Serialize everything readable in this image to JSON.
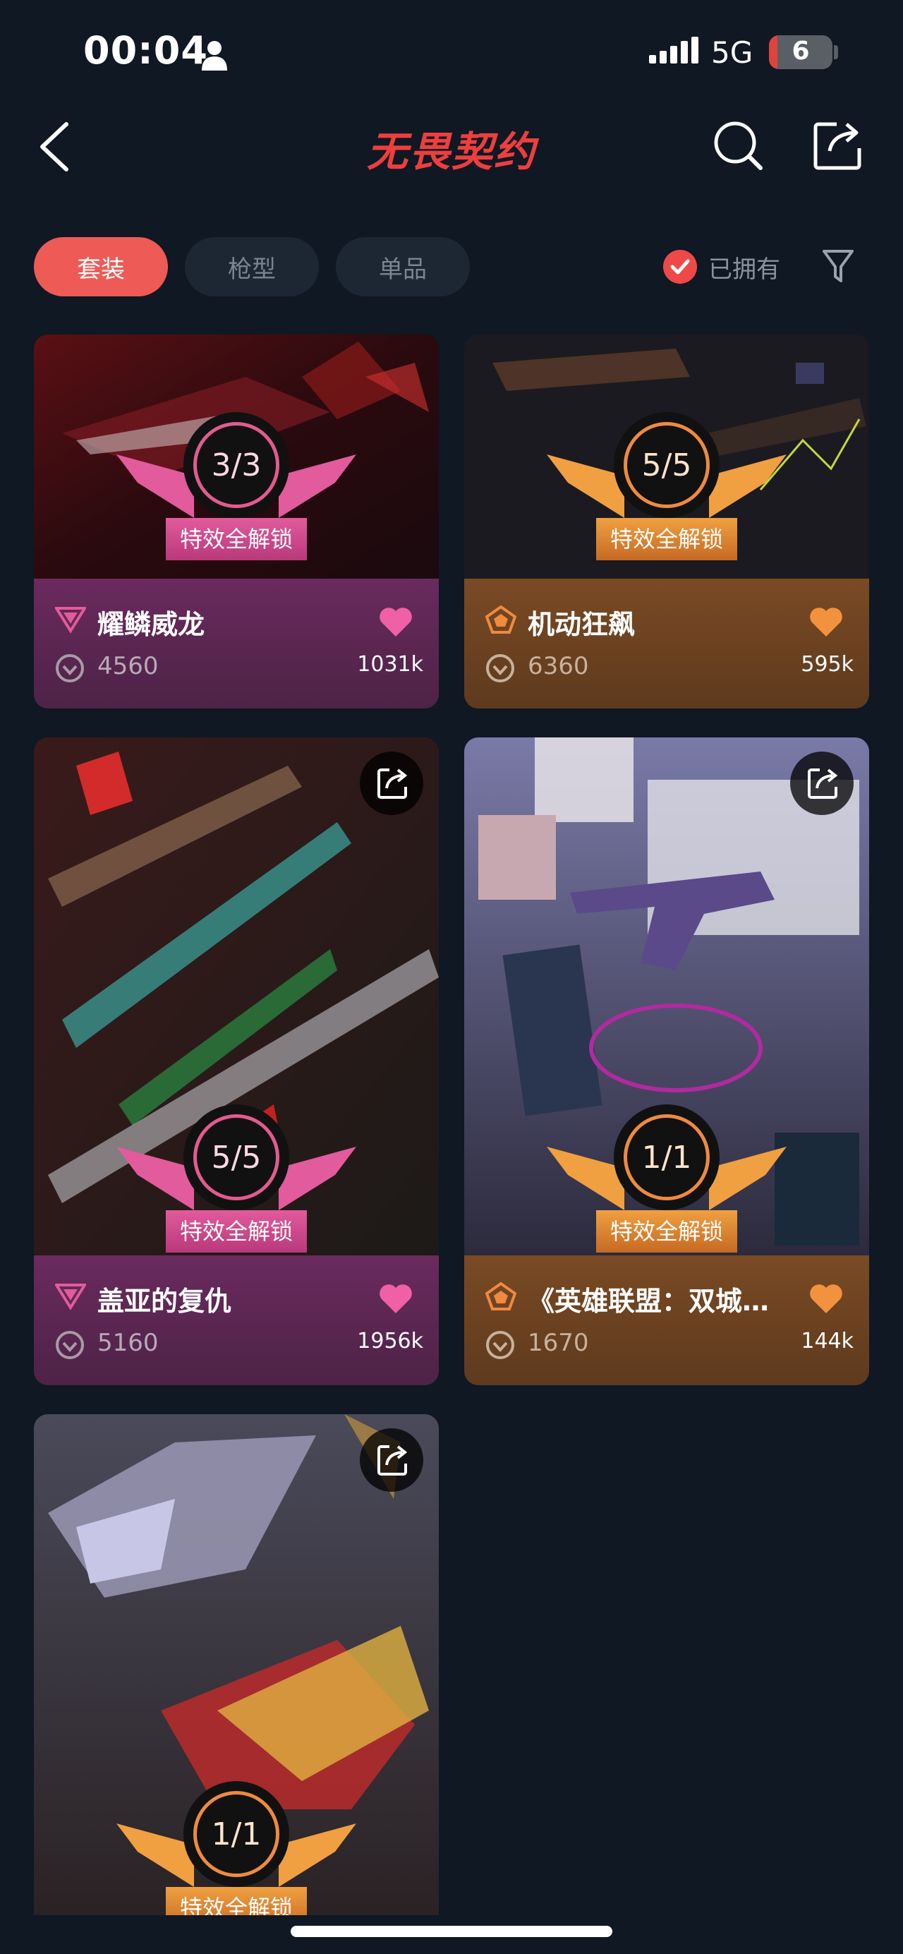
{
  "status_bar": {
    "time": "00:04",
    "network": "5G",
    "battery": "6"
  },
  "header": {
    "title": "无畏契约"
  },
  "filters": {
    "tabs": [
      {
        "label": "套装"
      },
      {
        "label": "枪型"
      },
      {
        "label": "单品"
      }
    ],
    "owned_label": "已拥有"
  },
  "cards": [
    {
      "name": "耀鳞威龙",
      "price": "4560",
      "likes": "1031k",
      "unlocked": "3/3",
      "badge_label": "特效全解锁"
    },
    {
      "name": "机动狂飙",
      "price": "6360",
      "likes": "595k",
      "unlocked": "5/5",
      "badge_label": "特效全解锁"
    },
    {
      "name": "盖亚的复仇",
      "price": "5160",
      "likes": "1956k",
      "unlocked": "5/5",
      "badge_label": "特效全解锁"
    },
    {
      "name": "《英雄联盟：双城…",
      "price": "1670",
      "likes": "144k",
      "unlocked": "1/1",
      "badge_label": "特效全解锁"
    },
    {
      "unlocked": "1/1",
      "badge_label": "特效全解锁"
    }
  ],
  "colors": {
    "accent": "#ee5a55",
    "pink_tier": "#e25b8e",
    "orange_tier": "#ef8a3e",
    "background": "#0f1823"
  }
}
